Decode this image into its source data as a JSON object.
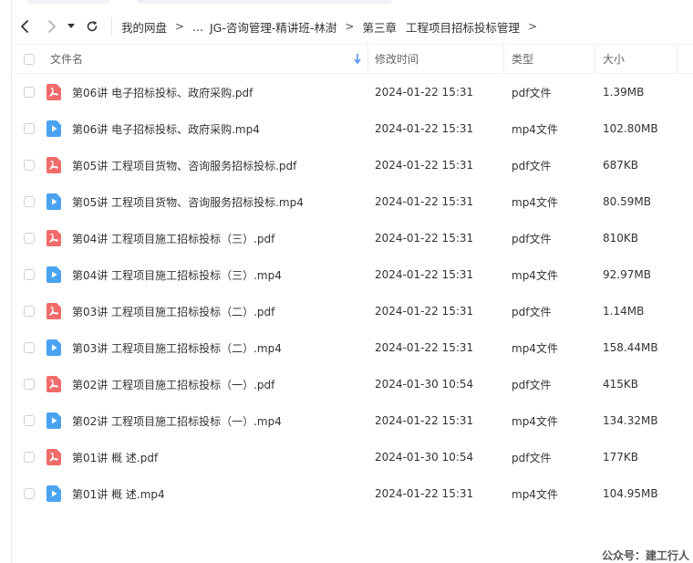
{
  "toolbar": {
    "breadcrumb": [
      "我的网盘",
      "...",
      "JG-咨询管理-精讲班-林澍",
      "第三章",
      "工程项目招标投标管理"
    ]
  },
  "table": {
    "headers": {
      "name": "文件名",
      "modified": "修改时间",
      "type": "类型",
      "size": "大小"
    },
    "rows": [
      {
        "name": "第06讲   电子招标投标、政府采购.pdf",
        "modified": "2024-01-22 15:31",
        "type": "pdf文件",
        "size": "1.39MB",
        "kind": "pdf"
      },
      {
        "name": "第06讲   电子招标投标、政府采购.mp4",
        "modified": "2024-01-22 15:31",
        "type": "mp4文件",
        "size": "102.80MB",
        "kind": "mp4"
      },
      {
        "name": "第05讲   工程项目货物、咨询服务招标投标.pdf",
        "modified": "2024-01-22 15:31",
        "type": "pdf文件",
        "size": "687KB",
        "kind": "pdf"
      },
      {
        "name": "第05讲   工程项目货物、咨询服务招标投标.mp4",
        "modified": "2024-01-22 15:31",
        "type": "mp4文件",
        "size": "80.59MB",
        "kind": "mp4"
      },
      {
        "name": "第04讲   工程项目施工招标投标（三）.pdf",
        "modified": "2024-01-22 15:31",
        "type": "pdf文件",
        "size": "810KB",
        "kind": "pdf"
      },
      {
        "name": "第04讲   工程项目施工招标投标（三）.mp4",
        "modified": "2024-01-22 15:31",
        "type": "mp4文件",
        "size": "92.97MB",
        "kind": "mp4"
      },
      {
        "name": "第03讲   工程项目施工招标投标（二）.pdf",
        "modified": "2024-01-22 15:31",
        "type": "pdf文件",
        "size": "1.14MB",
        "kind": "pdf"
      },
      {
        "name": "第03讲   工程项目施工招标投标（二）.mp4",
        "modified": "2024-01-22 15:31",
        "type": "mp4文件",
        "size": "158.44MB",
        "kind": "mp4"
      },
      {
        "name": "第02讲   工程项目施工招标投标（一）.pdf",
        "modified": "2024-01-30 10:54",
        "type": "pdf文件",
        "size": "415KB",
        "kind": "pdf"
      },
      {
        "name": "第02讲   工程项目施工招标投标（一）.mp4",
        "modified": "2024-01-22 15:31",
        "type": "mp4文件",
        "size": "134.32MB",
        "kind": "mp4"
      },
      {
        "name": "第01讲   概    述.pdf",
        "modified": "2024-01-30 10:54",
        "type": "pdf文件",
        "size": "177KB",
        "kind": "pdf"
      },
      {
        "name": "第01讲   概    述.mp4",
        "modified": "2024-01-22 15:31",
        "type": "mp4文件",
        "size": "104.95MB",
        "kind": "mp4"
      }
    ]
  },
  "icons": {
    "pdf": "pdf-file-icon",
    "mp4": "video-file-icon"
  },
  "colors": {
    "pdf_icon": "#f26b6b",
    "mp4_icon": "#4aa3f0",
    "sort_arrow": "#3b82f6"
  },
  "watermark": "公众号：建工行人"
}
